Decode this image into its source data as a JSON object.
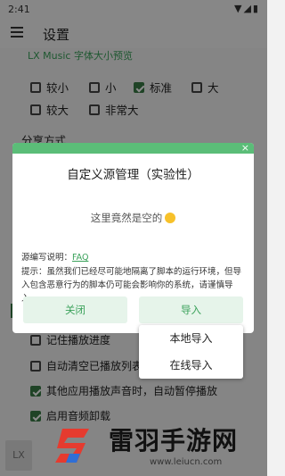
{
  "status_bar": {
    "time": "2:41",
    "icons": "▼◢▮"
  },
  "app_bar": {
    "title": "设置"
  },
  "font_preview": {
    "label": "LX Music 字体大小预览"
  },
  "font_sizes": [
    {
      "label": "较小",
      "checked": false
    },
    {
      "label": "小",
      "checked": false
    },
    {
      "label": "标准",
      "checked": true
    },
    {
      "label": "大",
      "checked": false
    },
    {
      "label": "较大",
      "checked": false
    },
    {
      "label": "非常大",
      "checked": false
    }
  ],
  "share_section": {
    "title": "分享方式"
  },
  "dialog": {
    "title": "自定义源管理（实验性）",
    "empty_text": "这里竟然是空的",
    "doc_label": "源编写说明：",
    "doc_link": "FAQ",
    "tip": "提示：虽然我们已经尽可能地隔离了脚本的运行环境，但导入包含恶意行为的脚本仍可能会影响你的系统，请谨慎导入。",
    "close_label": "关闭",
    "import_label": "导入",
    "close_icon": "×"
  },
  "import_menu": {
    "items": [
      "本地导入",
      "在线导入"
    ]
  },
  "settings_list": [
    {
      "label": "记住播放进度",
      "checked": false
    },
    {
      "label": "自动清空已播放列表",
      "checked": false
    },
    {
      "label": "其他应用播放声音时，自动暂停播放",
      "checked": true
    },
    {
      "label": "启用音频卸载",
      "checked": true
    }
  ],
  "bottom_tab": {
    "label": "LX"
  },
  "watermark": {
    "text": "雷羽手游网",
    "url": "www.leiucn.com"
  },
  "colors": {
    "accent": "#3aa15a",
    "dialog_top": "#5bbd78",
    "checkbox_on": "#3a7a45"
  }
}
